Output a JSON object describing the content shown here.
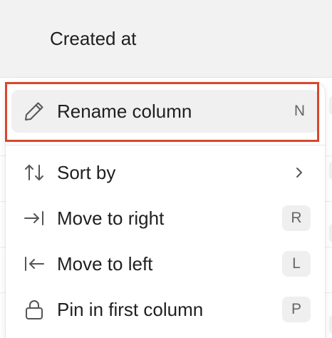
{
  "header": {
    "column_title": "Created at"
  },
  "menu": {
    "items": [
      {
        "label": "Rename column",
        "icon": "pencil-icon",
        "shortcut": "N",
        "shortcut_style": "plain",
        "active": true
      },
      {
        "label": "Sort by",
        "icon": "sort-arrows-icon",
        "submenu": true
      },
      {
        "label": "Move to right",
        "icon": "arrow-right-bar-icon",
        "shortcut": "R",
        "shortcut_style": "badge"
      },
      {
        "label": "Move to left",
        "icon": "arrow-left-bar-icon",
        "shortcut": "L",
        "shortcut_style": "badge"
      },
      {
        "label": "Pin in first column",
        "icon": "lock-icon",
        "shortcut": "P",
        "shortcut_style": "badge"
      }
    ]
  },
  "colors": {
    "highlight_border": "#d9472b",
    "active_item_bg": "#f0f0f0",
    "header_bg": "#f2f2f2",
    "text": "#1f1f1f",
    "muted_text": "#666666"
  }
}
